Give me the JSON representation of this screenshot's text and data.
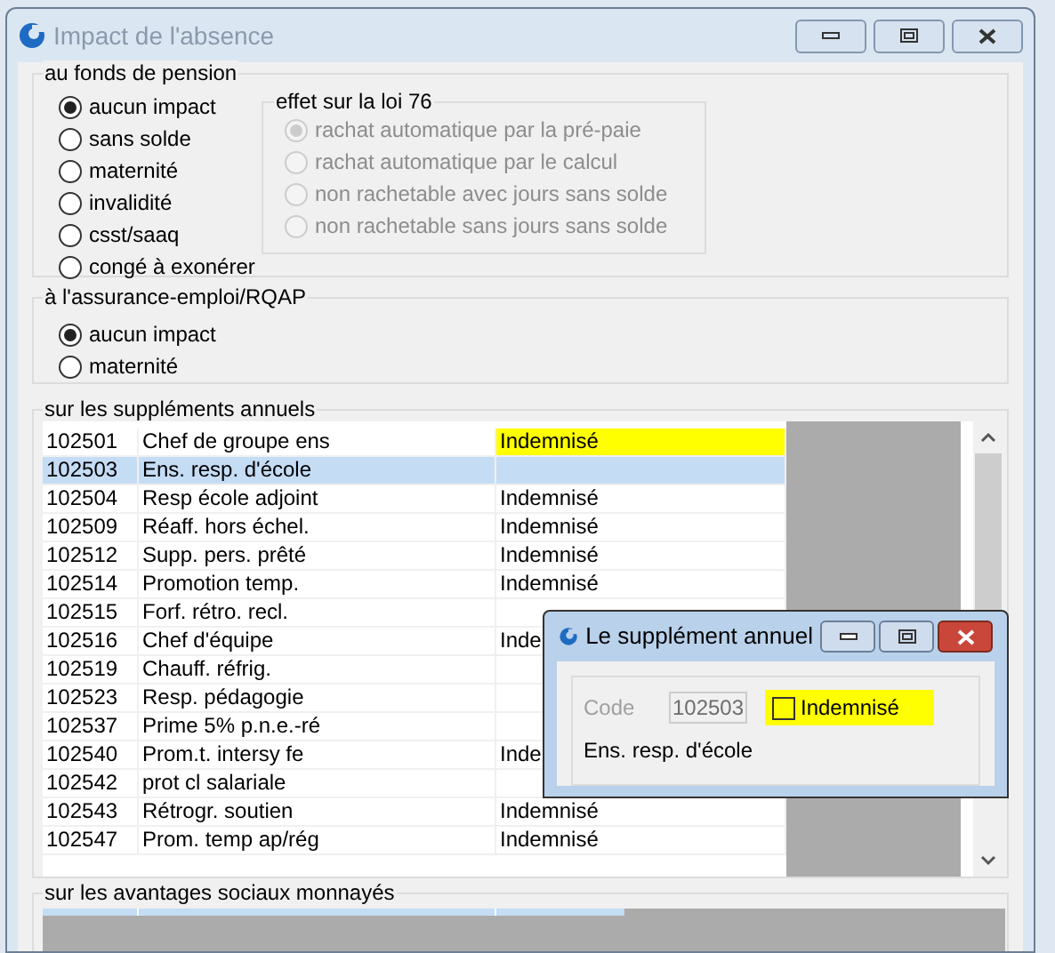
{
  "window": {
    "title": "Impact de l'absence"
  },
  "pension": {
    "title": "au fonds de pension",
    "options": [
      {
        "label": "aucun impact",
        "selected": true
      },
      {
        "label": "sans solde",
        "selected": false
      },
      {
        "label": "maternité",
        "selected": false
      },
      {
        "label": "invalidité",
        "selected": false
      },
      {
        "label": "csst/saaq",
        "selected": false
      },
      {
        "label": "congé à exonérer",
        "selected": false
      }
    ],
    "loi76": {
      "title": "effet sur la loi 76",
      "disabled": true,
      "options": [
        {
          "label": "rachat automatique par la pré-paie",
          "selected": true
        },
        {
          "label": "rachat automatique par le calcul",
          "selected": false
        },
        {
          "label": "non rachetable avec jours sans solde",
          "selected": false
        },
        {
          "label": "non rachetable sans jours sans solde",
          "selected": false
        }
      ]
    }
  },
  "assurance": {
    "title": "à l'assurance-emploi/RQAP",
    "options": [
      {
        "label": "aucun impact",
        "selected": true
      },
      {
        "label": "maternité",
        "selected": false
      }
    ]
  },
  "supplements": {
    "title": "sur les suppléments annuels",
    "rows": [
      {
        "code": "102501",
        "description": "Chef de groupe ens",
        "status": "Indemnisé",
        "selected": false,
        "highlighted": true
      },
      {
        "code": "102503",
        "description": "Ens. resp. d'école",
        "selected": true,
        "highlighted": false
      },
      {
        "code": "102504",
        "description": "Resp école adjoint",
        "status": "Indemnisé",
        "selected": false,
        "highlighted": false
      },
      {
        "code": "102509",
        "description": "Réaff. hors échel.",
        "status": "Indemnisé",
        "selected": false,
        "highlighted": false
      },
      {
        "code": "102512",
        "description": "Supp. pers. prêté",
        "status": "Indemnisé",
        "selected": false,
        "highlighted": false
      },
      {
        "code": "102514",
        "description": "Promotion temp.",
        "status": "Indemnisé",
        "selected": false,
        "highlighted": false
      },
      {
        "code": "102515",
        "description": "Forf. rétro. recl.",
        "selected": false,
        "highlighted": false
      },
      {
        "code": "102516",
        "description": "Chef d'équipe",
        "status": "Inde",
        "selected": false,
        "highlighted": false
      },
      {
        "code": "102519",
        "description": "Chauff. réfrig.",
        "selected": false,
        "highlighted": false
      },
      {
        "code": "102523",
        "description": "Resp. pédagogie",
        "selected": false,
        "highlighted": false
      },
      {
        "code": "102537",
        "description": "Prime 5% p.n.e.-ré",
        "selected": false,
        "highlighted": false
      },
      {
        "code": "102540",
        "description": "Prom.t. intersy fe",
        "status": "Inde",
        "selected": false,
        "highlighted": false
      },
      {
        "code": "102542",
        "description": "prot cl salariale",
        "selected": false,
        "highlighted": false
      },
      {
        "code": "102543",
        "description": "Rétrogr. soutien",
        "status": "Indemnisé",
        "selected": false,
        "highlighted": false
      },
      {
        "code": "102547",
        "description": "Prom. temp ap/rég",
        "status": "Indemnisé",
        "selected": false,
        "highlighted": false
      }
    ]
  },
  "avantages": {
    "title": "sur les avantages sociaux monnayés"
  },
  "dialog": {
    "title": "Le supplément annuel",
    "code_label": "Code",
    "code": "102503",
    "checkbox": {
      "label": "Indemnisé",
      "checked": false,
      "highlighted": true
    },
    "description": "Ens. resp. d'école"
  }
}
